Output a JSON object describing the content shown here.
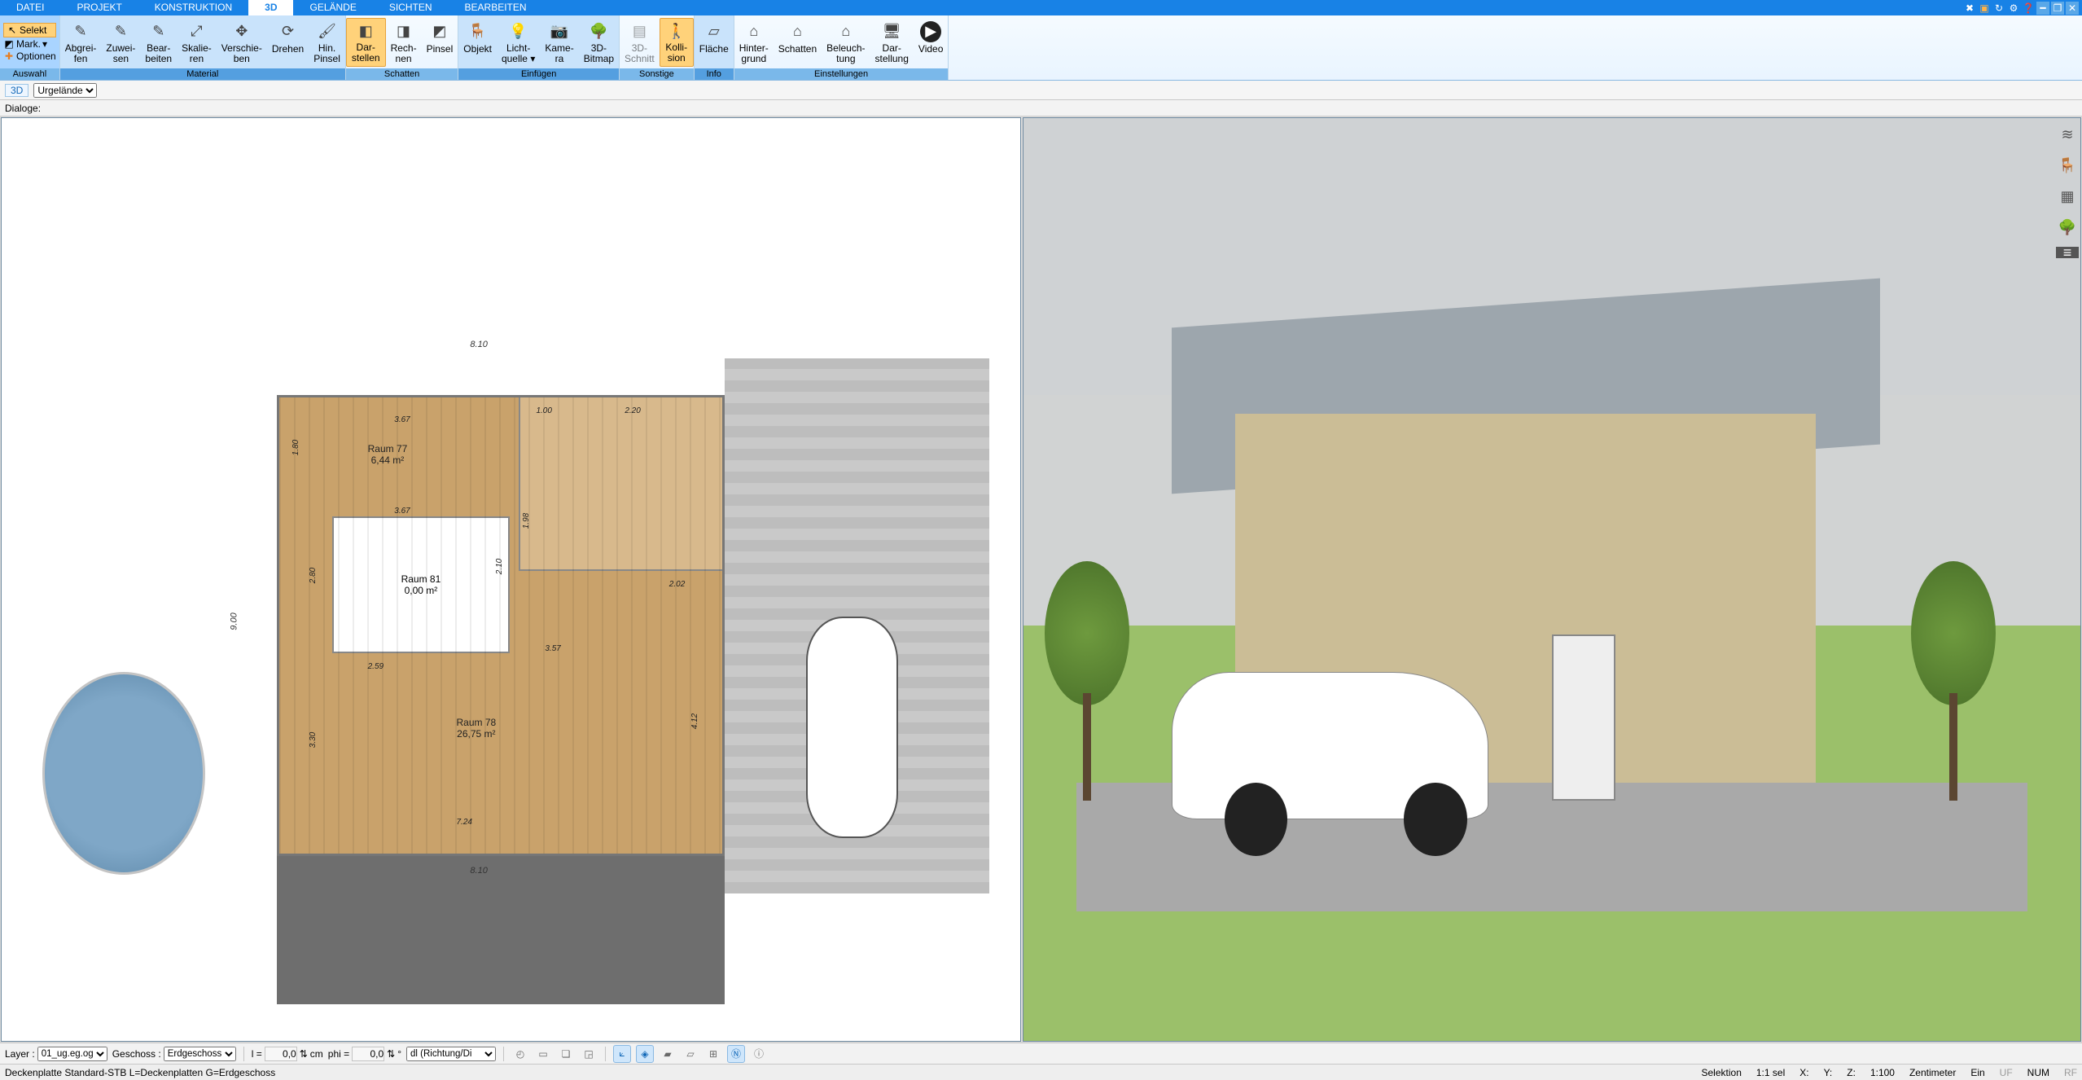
{
  "tabs": {
    "items": [
      "DATEI",
      "PROJEKT",
      "KONSTRUKTION",
      "3D",
      "GELÄNDE",
      "SICHTEN",
      "BEARBEITEN"
    ],
    "active": "3D"
  },
  "titlebar_icons": [
    "tools-icon",
    "gift-icon",
    "refresh-icon",
    "settings-icon",
    "help-icon",
    "minimize-icon",
    "restore-icon",
    "close-icon"
  ],
  "ribbon": {
    "selection": {
      "selekt": "Selekt",
      "mark": "Mark.",
      "optionen": "Optionen",
      "group_label": "Auswahl"
    },
    "material": {
      "items": [
        {
          "id": "abgreifen",
          "l1": "Abgrei-",
          "l2": "fen"
        },
        {
          "id": "zuweisen",
          "l1": "Zuwei-",
          "l2": "sen"
        },
        {
          "id": "bearbeiten",
          "l1": "Bear-",
          "l2": "beiten"
        },
        {
          "id": "skalieren",
          "l1": "Skalie-",
          "l2": "ren"
        },
        {
          "id": "verschieben",
          "l1": "Verschie-",
          "l2": "ben"
        },
        {
          "id": "drehen",
          "l1": "Drehen",
          "l2": ""
        },
        {
          "id": "hinpinsel",
          "l1": "Hin.",
          "l2": "Pinsel"
        }
      ],
      "group_label": "Material"
    },
    "schatten": {
      "items": [
        {
          "id": "darstellen",
          "l1": "Dar-",
          "l2": "stellen",
          "hl": true
        },
        {
          "id": "rechnen",
          "l1": "Rech-",
          "l2": "nen"
        },
        {
          "id": "pinsel",
          "l1": "Pinsel",
          "l2": ""
        }
      ],
      "group_label": "Schatten"
    },
    "einfuegen": {
      "items": [
        {
          "id": "objekt",
          "l1": "Objekt",
          "l2": ""
        },
        {
          "id": "lichtquelle",
          "l1": "Licht-",
          "l2": "quelle ▾"
        },
        {
          "id": "kamera",
          "l1": "Kame-",
          "l2": "ra"
        },
        {
          "id": "3dbitmap",
          "l1": "3D-",
          "l2": "Bitmap"
        }
      ],
      "group_label": "Einfügen"
    },
    "sonstige": {
      "items": [
        {
          "id": "3dschnitt",
          "l1": "3D-",
          "l2": "Schnitt",
          "dis": true
        },
        {
          "id": "kollision",
          "l1": "Kolli-",
          "l2": "sion",
          "hl": true
        }
      ],
      "group_label": "Sonstige"
    },
    "info": {
      "items": [
        {
          "id": "flaeche",
          "l1": "Fläche",
          "l2": ""
        }
      ],
      "group_label": "Info"
    },
    "einstellungen": {
      "items": [
        {
          "id": "hintergrund",
          "l1": "Hinter-",
          "l2": "grund"
        },
        {
          "id": "schatten2",
          "l1": "Schatten",
          "l2": ""
        },
        {
          "id": "beleuchtung",
          "l1": "Beleuch-",
          "l2": "tung"
        },
        {
          "id": "darstellung",
          "l1": "Dar-",
          "l2": "stellung"
        },
        {
          "id": "video",
          "l1": "Video",
          "l2": ""
        }
      ],
      "group_label": "Einstellungen"
    }
  },
  "ctx": {
    "mode": "3D",
    "layer_sel": "Urgelände",
    "dialoge": "Dialoge:"
  },
  "floorplan": {
    "outer_w": "8.10",
    "outer_h": "9.00",
    "room77": {
      "name": "Raum 77",
      "area": "6,44 m²",
      "w": "3.67"
    },
    "room81": {
      "name": "Raum 81",
      "area": "0,00 m²",
      "w": "3.67",
      "h": "2.80"
    },
    "room78": {
      "name": "Raum 78",
      "area": "26,75 m²",
      "w": "7.24"
    },
    "dims": {
      "d1": "1.80",
      "d2": "2.10",
      "d3": "2.59",
      "d4": "3.30",
      "d5": "4.12",
      "d6": "3.57",
      "d7": "1.00",
      "d8": "2.20",
      "d9": "1.98",
      "d10": "2.02",
      "d11": "3.67"
    },
    "terrace_w": "8.10"
  },
  "bottom": {
    "layer_lbl": "Layer :",
    "layer_val": "01_ug.eg.og",
    "geschoss_lbl": "Geschoss :",
    "geschoss_val": "Erdgeschoss",
    "l_lbl": "l =",
    "l_val": "0,0",
    "l_unit": "cm",
    "phi_lbl": "phi =",
    "phi_val": "0,0",
    "phi_unit": "°",
    "dl_val": "dl (Richtung/Di"
  },
  "status": {
    "left": "Deckenplatte Standard-STB L=Deckenplatten G=Erdgeschoss",
    "selektion": "Selektion",
    "sel": "1:1 sel",
    "x": "X:",
    "y": "Y:",
    "z": "Z:",
    "scale": "1:100",
    "unit": "Zentimeter",
    "ein": "Ein",
    "uf": "UF",
    "num": "NUM",
    "rf": "RF"
  }
}
